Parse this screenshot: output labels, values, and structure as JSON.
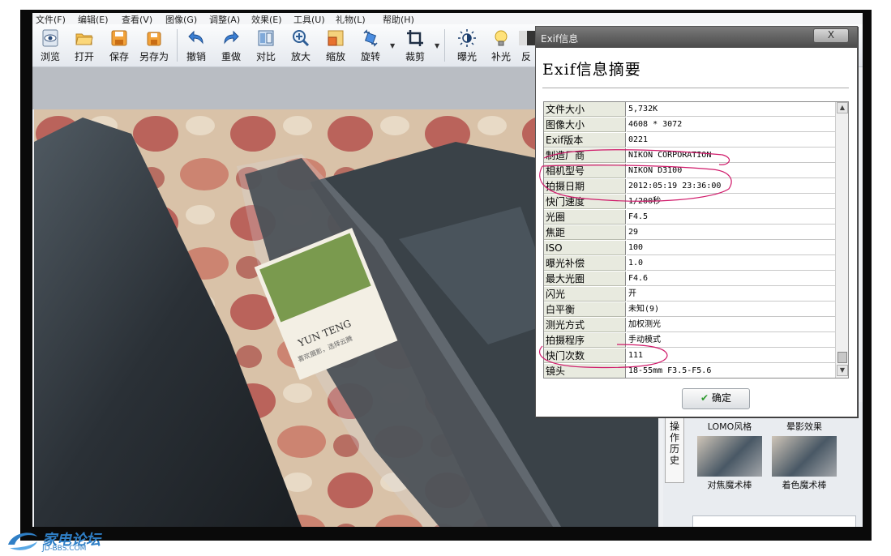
{
  "menu": [
    "文件(F)",
    "编辑(E)",
    "查看(V)",
    "图像(G)",
    "调整(A)",
    "效果(E)",
    "工具(U)",
    "礼物(L)",
    "帮助(H)"
  ],
  "toolbar": [
    {
      "label": "浏览",
      "icon": "eye-icon"
    },
    {
      "label": "打开",
      "icon": "folder-open-icon"
    },
    {
      "label": "保存",
      "icon": "save-icon"
    },
    {
      "label": "另存为",
      "icon": "save-as-icon"
    },
    {
      "label": "撤销",
      "icon": "undo-icon"
    },
    {
      "label": "重做",
      "icon": "redo-icon"
    },
    {
      "label": "对比",
      "icon": "compare-icon"
    },
    {
      "label": "放大",
      "icon": "zoom-in-icon"
    },
    {
      "label": "缩放",
      "icon": "resize-icon"
    },
    {
      "label": "旋转",
      "icon": "rotate-icon"
    },
    {
      "label": "裁剪",
      "icon": "crop-icon"
    },
    {
      "label": "曝光",
      "icon": "exposure-icon"
    },
    {
      "label": "补光",
      "icon": "fill-light-icon"
    },
    {
      "label": "反",
      "icon": "invert-icon"
    }
  ],
  "photo": {
    "package_text": "YUN TENG",
    "package_sub": "喜欢摄影，选择云腾"
  },
  "right_panel": {
    "tab_label": "操作历史",
    "effects": [
      {
        "label": "LOMO风格"
      },
      {
        "label": "晕影效果"
      },
      {
        "label": "对焦魔术棒"
      },
      {
        "label": "着色魔术棒"
      }
    ]
  },
  "dialog": {
    "title": "Exif信息",
    "close": "X",
    "heading": "Exif信息摘要",
    "rows": [
      {
        "key": "文件大小",
        "value": "5,732K"
      },
      {
        "key": "图像大小",
        "value": "4608 * 3072"
      },
      {
        "key": "Exif版本",
        "value": "0221"
      },
      {
        "key": "制造厂商",
        "value": "NIKON CORPORATION"
      },
      {
        "key": "相机型号",
        "value": "NIKON D3100"
      },
      {
        "key": "拍摄日期",
        "value": "2012:05:19 23:36:00"
      },
      {
        "key": "快门速度",
        "value": "1/200秒"
      },
      {
        "key": "光圈",
        "value": "F4.5"
      },
      {
        "key": "焦距",
        "value": "29"
      },
      {
        "key": "ISO",
        "value": "100"
      },
      {
        "key": "曝光补偿",
        "value": "1.0"
      },
      {
        "key": "最大光圈",
        "value": "F4.6"
      },
      {
        "key": "闪光",
        "value": "开"
      },
      {
        "key": "白平衡",
        "value": "未知(9)"
      },
      {
        "key": "测光方式",
        "value": "加权测光"
      },
      {
        "key": "拍摄程序",
        "value": "手动模式"
      },
      {
        "key": "快门次数",
        "value": "111"
      },
      {
        "key": "镜头",
        "value": "18-55mm F3.5-F5.6"
      }
    ],
    "ok_label": "确定"
  },
  "watermark": {
    "name": "家电论坛",
    "url": "JD-BBS.COM"
  },
  "colors": {
    "annotation": "#d01a6a",
    "accent": "#2f7fc6"
  }
}
